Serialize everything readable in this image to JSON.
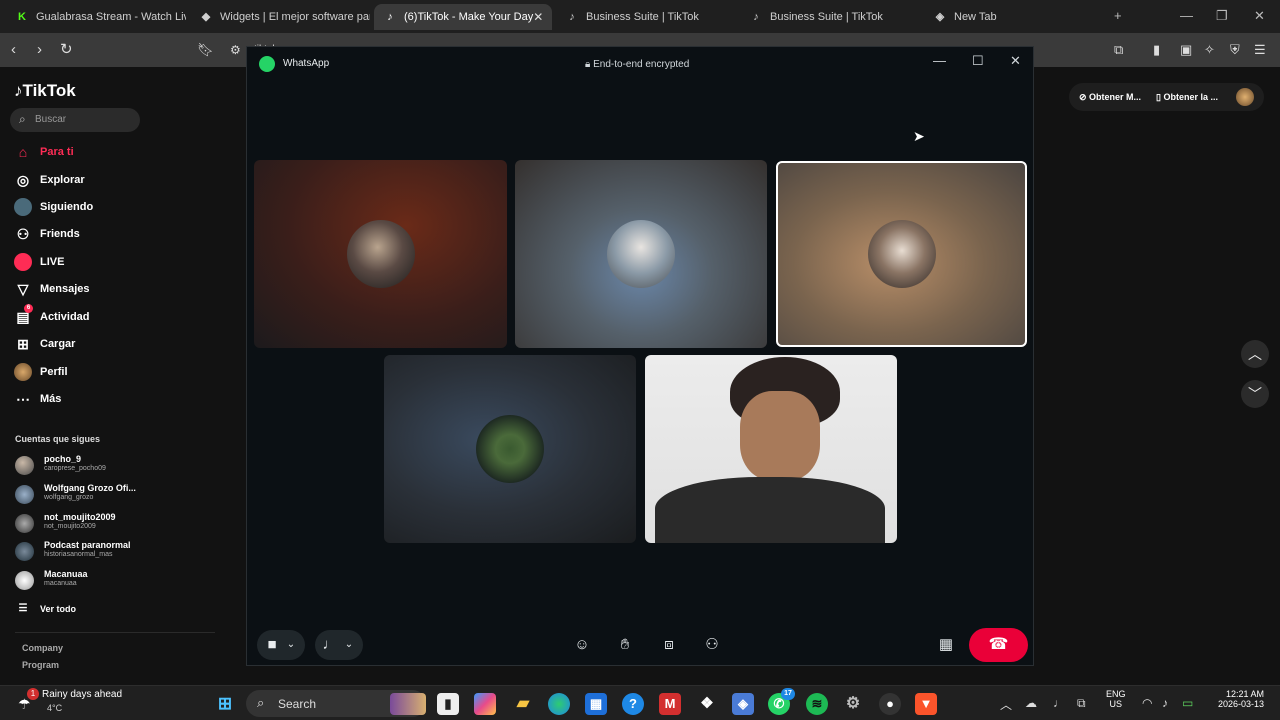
{
  "browser": {
    "tabs": [
      {
        "label": "Gualabrasa Stream - Watch Live",
        "favicon": "K",
        "favicon_color": "#53fc18"
      },
      {
        "label": "Widgets | El mejor software para",
        "favicon": "◆",
        "favicon_color": "#ffffff"
      },
      {
        "label": "(6)TikTok - Make Your Day",
        "favicon": "♪",
        "favicon_color": "#ffffff"
      },
      {
        "label": "Business Suite | TikTok",
        "favicon": "♪",
        "favicon_color": "#ffffff"
      },
      {
        "label": "Business Suite | TikTok",
        "favicon": "♪",
        "favicon_color": "#ffffff"
      },
      {
        "label": "New Tab",
        "favicon": "◈",
        "favicon_color": "#cccccc"
      }
    ],
    "address_partial": "tiktok"
  },
  "tiktok": {
    "logo": "TikTok",
    "search_placeholder": "Buscar",
    "nav": [
      {
        "label": "Para ti",
        "icon": "home-icon"
      },
      {
        "label": "Explorar",
        "icon": "compass-icon"
      },
      {
        "label": "Siguiendo",
        "icon": "following-avatar-icon"
      },
      {
        "label": "Friends",
        "icon": "friends-icon"
      },
      {
        "label": "LIVE",
        "icon": "live-icon"
      },
      {
        "label": "Mensajes",
        "icon": "message-icon"
      },
      {
        "label": "Actividad",
        "icon": "activity-icon",
        "badge": "6"
      },
      {
        "label": "Cargar",
        "icon": "upload-icon"
      },
      {
        "label": "Perfil",
        "icon": "profile-icon"
      },
      {
        "label": "Más",
        "icon": "more-icon"
      }
    ],
    "following_title": "Cuentas que sigues",
    "accounts": [
      {
        "name": "pocho_9",
        "handle": "caroprese_pocho09"
      },
      {
        "name": "Wolfgang Grozo Ofi...",
        "handle": "wolfgang_grozo"
      },
      {
        "name": "not_moujito2009",
        "handle": "not_moujito2009"
      },
      {
        "name": "Podcast paranormal",
        "handle": "historiasanormal_mas"
      },
      {
        "name": "Macanuaa",
        "handle": "macanuaa"
      }
    ],
    "see_all": "Ver todo",
    "footer": [
      "Company",
      "Program"
    ],
    "right_pill": [
      "Obtener M...",
      "Obtener la ..."
    ]
  },
  "whatsapp": {
    "title": "WhatsApp",
    "encryption": "End-to-end encrypted",
    "accent": "#25d366",
    "end_call_color": "#ea0038"
  },
  "taskbar": {
    "weather_title": "Rainy days ahead",
    "weather_temp": "4°C",
    "weather_badge": "1",
    "search": "Search",
    "lang": "ENG",
    "region": "US",
    "time": "12:21 AM",
    "date": "2026-03-13",
    "whatsapp_badge": "17"
  }
}
